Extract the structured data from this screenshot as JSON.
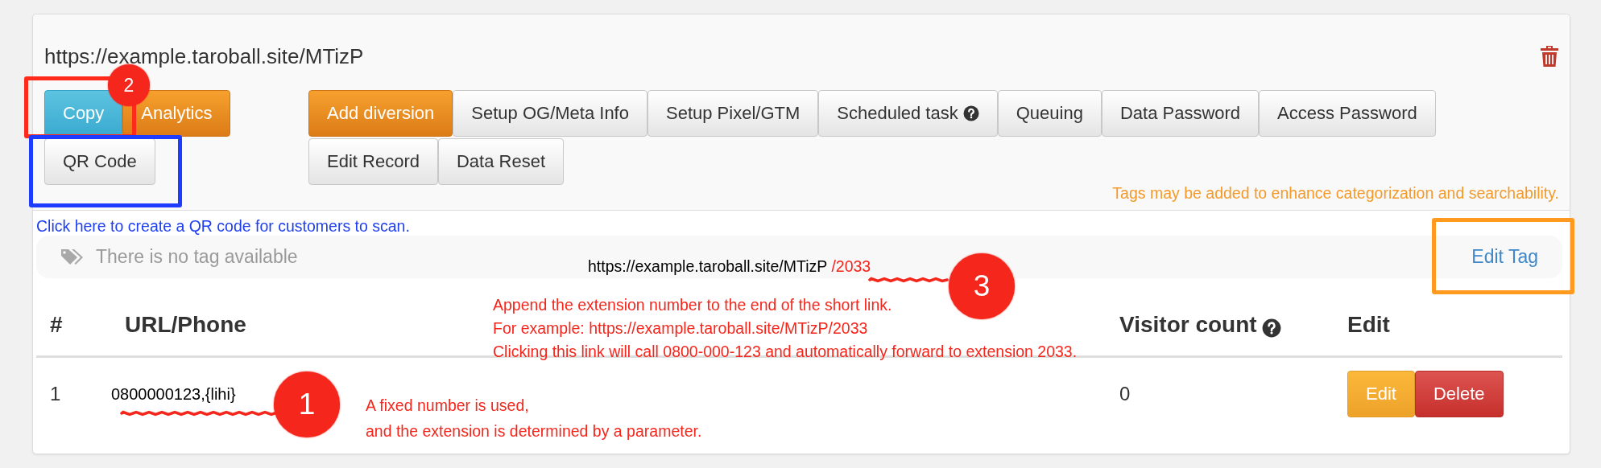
{
  "link": {
    "url": "https://example.taroball.site/MTizP"
  },
  "left_buttons": [
    {
      "label": "Copy",
      "kind": "info"
    },
    {
      "label": "Analytics",
      "kind": "warning"
    },
    {
      "label": "QR Code",
      "kind": "default"
    }
  ],
  "action_buttons": [
    {
      "label": "Add diversion",
      "kind": "warning",
      "help": false
    },
    {
      "label": "Setup OG/Meta Info",
      "kind": "default",
      "help": false
    },
    {
      "label": "Setup Pixel/GTM",
      "kind": "default",
      "help": false
    },
    {
      "label": "Scheduled task",
      "kind": "default",
      "help": true
    },
    {
      "label": "Queuing",
      "kind": "default",
      "help": false
    },
    {
      "label": "Data Password",
      "kind": "default",
      "help": false
    },
    {
      "label": "Access Password",
      "kind": "default",
      "help": false
    },
    {
      "label": "Edit Record",
      "kind": "default",
      "help": false
    },
    {
      "label": "Data Reset",
      "kind": "default",
      "help": false
    }
  ],
  "tag_hint": "Tags may be added to enhance categorization and searchability.",
  "qr_hint": "Click here to create a QR code for customers to scan.",
  "tags": {
    "empty_text": "There is no tag available",
    "edit_link": "Edit Tag"
  },
  "table": {
    "columns": [
      {
        "label": "#",
        "help": false
      },
      {
        "label": "URL/Phone",
        "help": false
      },
      {
        "label": "Visitor count",
        "help": true
      },
      {
        "label": "Edit",
        "help": false
      }
    ],
    "rows": [
      {
        "index": "1",
        "url": "0800000123,{lihi}",
        "visitors": "0",
        "actions": [
          {
            "label": "Edit",
            "kind": "warning"
          },
          {
            "label": "Delete",
            "kind": "danger"
          }
        ]
      }
    ]
  },
  "annotations": {
    "badges": [
      {
        "label": "2"
      },
      {
        "label": "3"
      },
      {
        "label": "1"
      }
    ],
    "frames": [
      {
        "color": "#ff2a1a"
      },
      {
        "color": "#1e3cff"
      },
      {
        "color": "#ff9a1e"
      }
    ],
    "example_link": {
      "url": "https://example.taroball.site/MTizP",
      "suffix": "/2033"
    },
    "notes": [
      {
        "lines": [
          "Append the extension number to the end of the short link.",
          "For example: https://example.taroball.site/MTizP/2033",
          "Clicking this link will call 0800-000-123 and automatically forward to extension 2033."
        ]
      },
      {
        "lines": [
          "A fixed number is used,",
          "and the extension is determined by a parameter."
        ]
      }
    ]
  }
}
